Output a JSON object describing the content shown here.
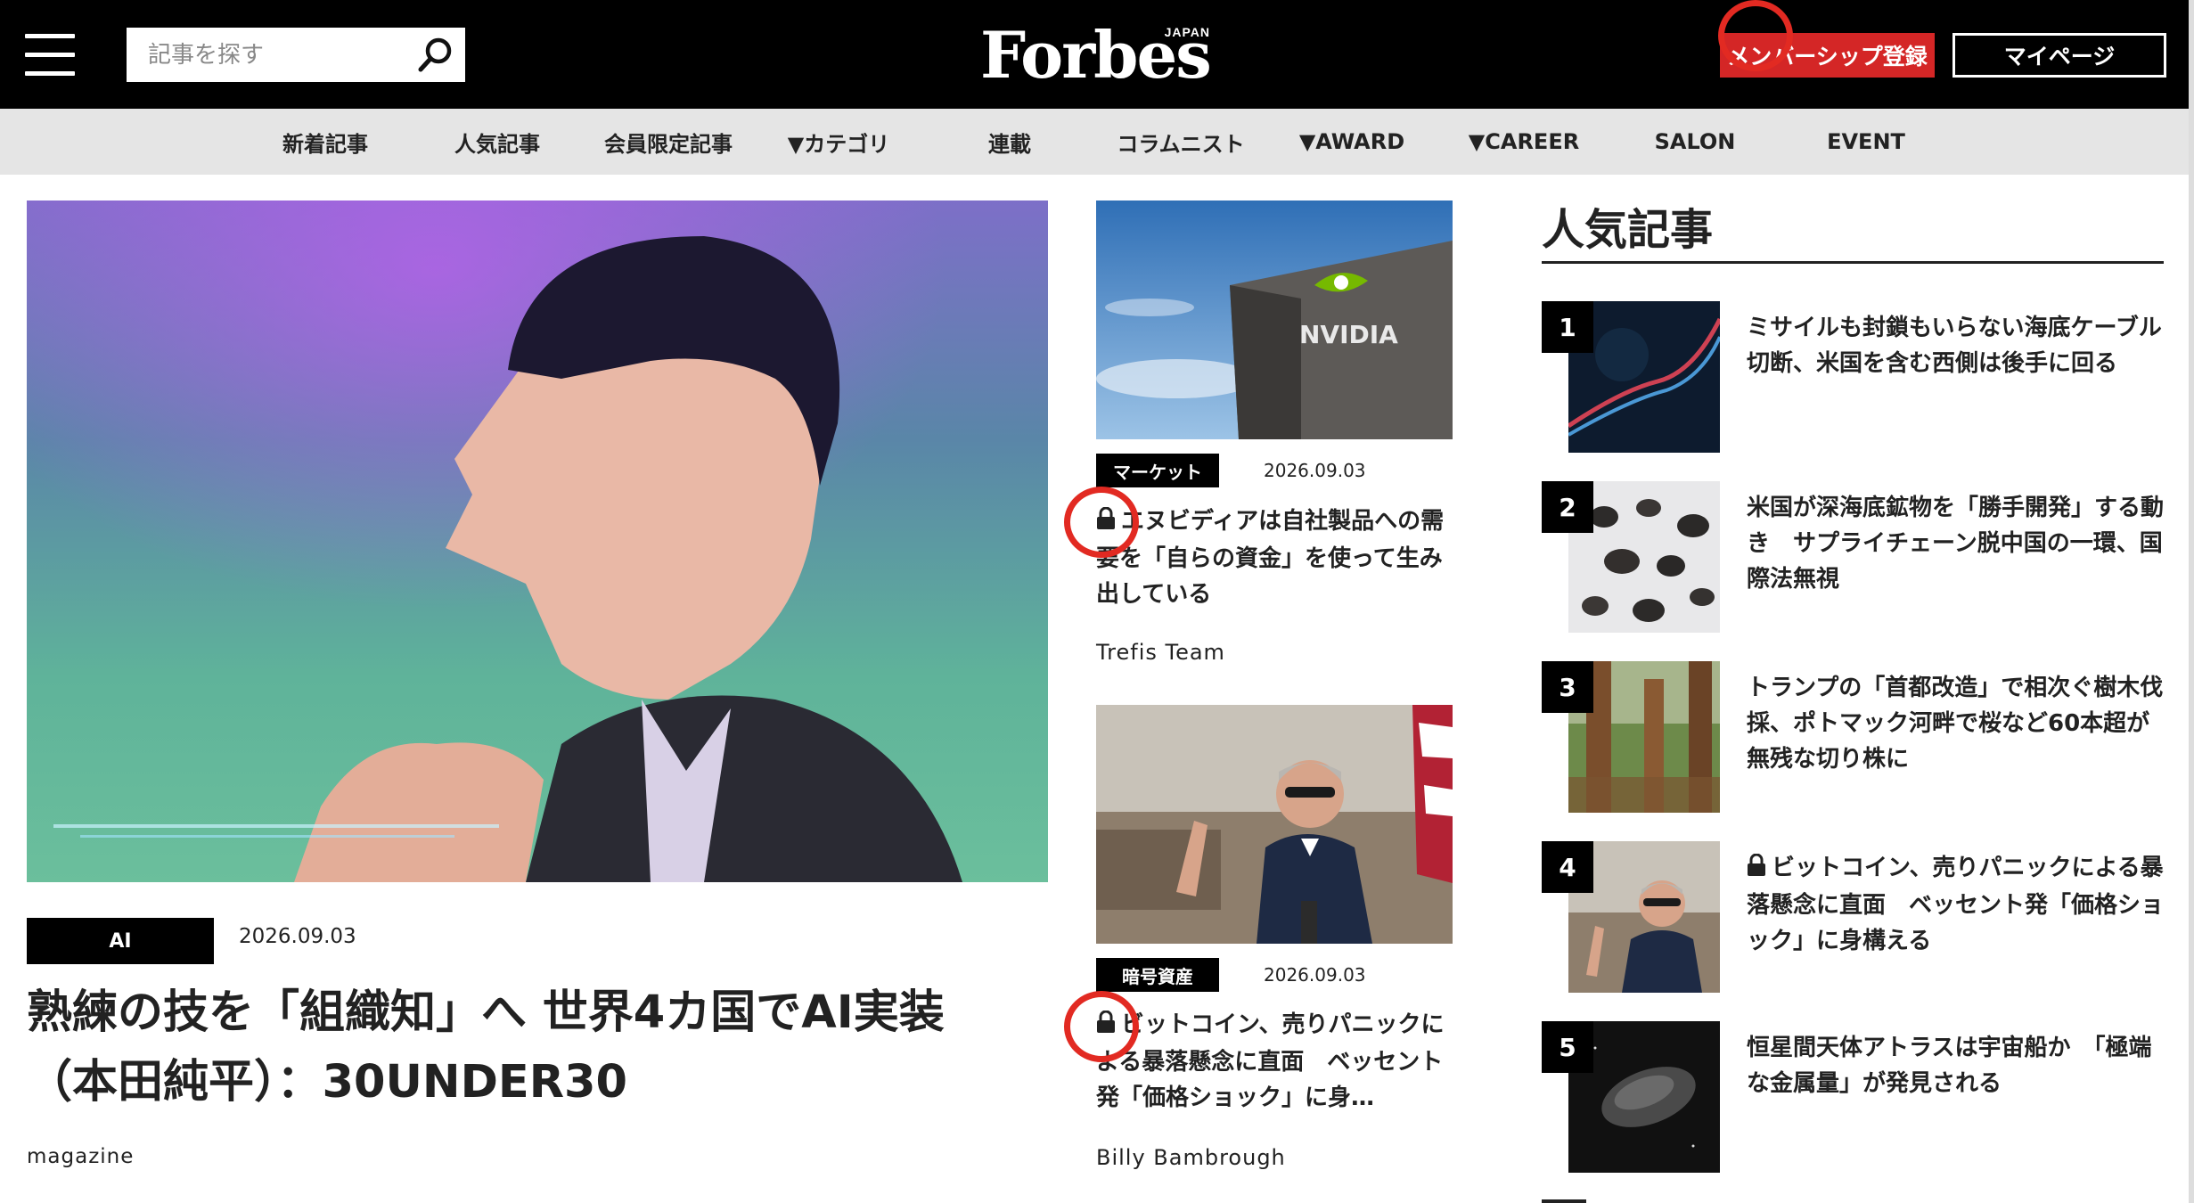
{
  "header": {
    "search_placeholder": "記事を探す",
    "logo_word": "Forbes",
    "logo_sub": "JAPAN",
    "member_button": "メンバーシップ登録",
    "mypage_button": "マイページ"
  },
  "nav": [
    "新着記事",
    "人気記事",
    "会員限定記事",
    "▼カテゴリ",
    "連載",
    "コラムニスト",
    "▼AWARD",
    "▼CAREER",
    "SALON",
    "EVENT"
  ],
  "feature": {
    "tag": "AI",
    "date": "2026.09.03",
    "title_line1": "熟練の技を「組織知」へ 世界4カ国でAI実装",
    "title_line2": "（本田純平）：30UNDER30",
    "author": "magazine"
  },
  "middle": [
    {
      "tag": "マーケット",
      "date": "2026.09.03",
      "title": "エヌビディアは自社製品への需要を「自らの資金」を使って生み出している",
      "author": "Trefis Team",
      "members_only": true,
      "image_text": "NVIDIA"
    },
    {
      "tag": "暗号資産",
      "date": "2026.09.03",
      "title": "ビットコイン、売りパニックによる暴落懸念に直面　ベッセント発「価格ショック」に身…",
      "author": "Billy Bambrough",
      "members_only": true
    }
  ],
  "ranking": {
    "heading": "人気記事",
    "items": [
      {
        "rank": "1",
        "title": "ミサイルも封鎖もいらない海底ケーブル切断、米国を含む西側は後手に回る",
        "members_only": false
      },
      {
        "rank": "2",
        "title": "米国が深海底鉱物を「勝手開発」する動き　サプライチェーン脱中国の一環、国際法無視",
        "members_only": false
      },
      {
        "rank": "3",
        "title": "トランプの「首都改造」で相次ぐ樹木伐採、ポトマック河畔で桜など60本超が無残な切り株に",
        "members_only": false
      },
      {
        "rank": "4",
        "title": "ビットコイン、売りパニックによる暴落懸念に直面　ベッセント発「価格ショック」に身構える",
        "members_only": true
      },
      {
        "rank": "5",
        "title": "恒星間天体アトラスは宇宙船か　「極端な金属量」が発見される",
        "members_only": false
      }
    ]
  },
  "colors": {
    "header_bg": "#000000",
    "nav_bg": "#e5e5e5",
    "member_button_bg": "#d42626",
    "highlight_ring": "#e22a22"
  },
  "icons": [
    "menu-icon",
    "search-icon",
    "lock-icon"
  ]
}
